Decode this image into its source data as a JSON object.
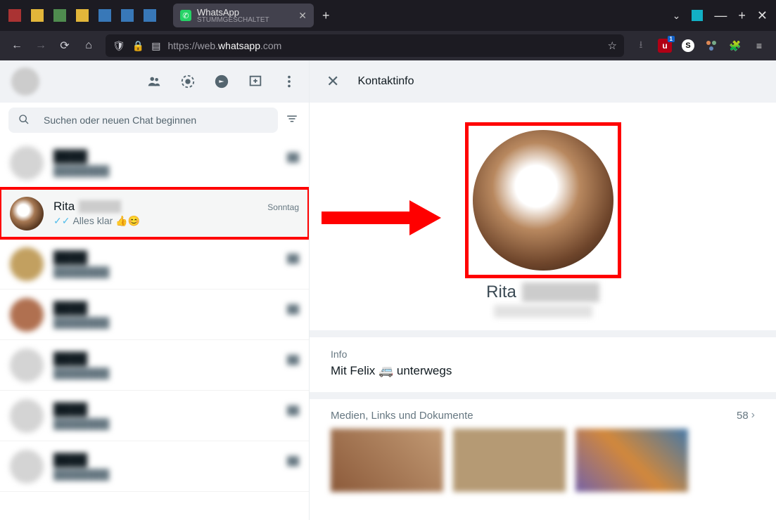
{
  "browser": {
    "tab_title": "WhatsApp",
    "tab_subtitle": "STUMMGESCHALTET",
    "url_pre": "https://web.",
    "url_host": "whatsapp",
    "url_post": ".com"
  },
  "sidebar": {
    "search_placeholder": "Suchen oder neuen Chat beginnen"
  },
  "highlighted_chat": {
    "name": "Rita",
    "time": "Sonntag",
    "preview": "Alles klar 👍😊"
  },
  "panel": {
    "title": "Kontaktinfo",
    "profile_name": "Rita",
    "info_label": "Info",
    "info_text": "Mit Felix 🚐 unterwegs",
    "media_label": "Medien, Links und Dokumente",
    "media_count": "58"
  }
}
